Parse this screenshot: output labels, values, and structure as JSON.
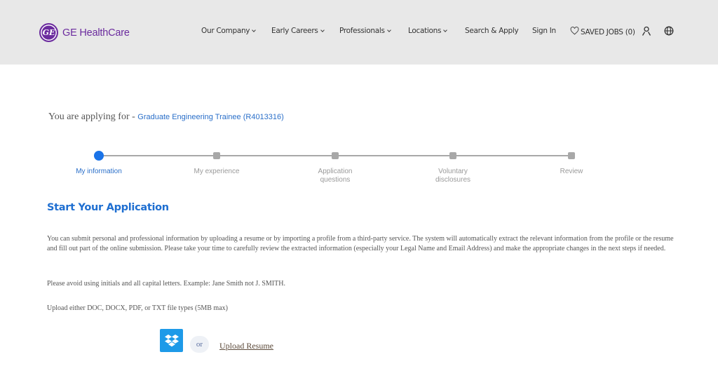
{
  "header": {
    "logo_mark": "GE",
    "logo_text": "GE HealthCare",
    "brand_color": "#6b2b9e",
    "nav": [
      {
        "label": "Our Company",
        "has_dropdown": true
      },
      {
        "label": "Early Careers",
        "has_dropdown": true
      },
      {
        "label": "Professionals",
        "has_dropdown": true
      },
      {
        "label": "Locations",
        "has_dropdown": true
      },
      {
        "label": "Search & Apply",
        "has_dropdown": false
      },
      {
        "label": "Sign In",
        "has_dropdown": false
      }
    ],
    "saved_jobs_label": "SAVED JOBS (0)",
    "icons": [
      "heart-icon",
      "user-icon",
      "globe-icon"
    ]
  },
  "applying": {
    "prefix": "You are applying for - ",
    "job_title": "Graduate Engineering Trainee (R4013316)"
  },
  "stepper": {
    "active_index": 0,
    "active_color": "#1a73e8",
    "steps": [
      {
        "label_line1": "My information",
        "label_line2": ""
      },
      {
        "label_line1": "My experience",
        "label_line2": ""
      },
      {
        "label_line1": "Application",
        "label_line2": "questions"
      },
      {
        "label_line1": "Voluntary",
        "label_line2": "disclosures"
      },
      {
        "label_line1": "Review",
        "label_line2": ""
      }
    ]
  },
  "main": {
    "title": "Start Your Application",
    "intro": "You can submit personal and professional information by uploading a resume or by importing a profile from a third-party service. The system will automatically extract the relevant information from the profile or the resume and fill out part of the online submission. Please take your time to carefully review the extracted information (especially your Legal Name and Email Address) and make the appropriate changes in the next steps if needed.",
    "name_note": "Please avoid using initials and all capital letters. Example: Jane Smith not J. SMITH.",
    "file_note": "Upload either DOC, DOCX, PDF, or TXT file types (5MB max)",
    "or_label": "or",
    "upload_label": "Upload Resume",
    "dropbox_icon": "dropbox-icon"
  }
}
